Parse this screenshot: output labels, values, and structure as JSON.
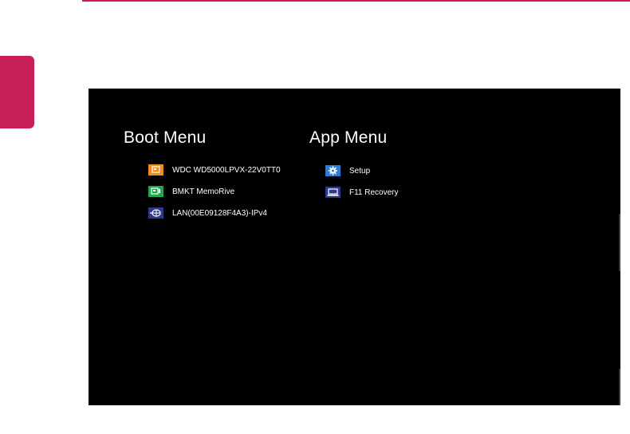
{
  "boot_menu": {
    "title": "Boot Menu",
    "items": [
      {
        "label": "WDC WD5000LPVX-22V0TT0",
        "icon": "hdd-icon",
        "color": "#f08c1e"
      },
      {
        "label": "BMKT MemoRive",
        "icon": "usb-drive-icon",
        "color": "#1fa84a"
      },
      {
        "label": "LAN(00E09128F4A3)-IPv4",
        "icon": "network-icon",
        "color": "#2d3a8c"
      }
    ]
  },
  "app_menu": {
    "title": "App Menu",
    "items": [
      {
        "label": "Setup",
        "icon": "gear-icon",
        "color": "#2a7fd4"
      },
      {
        "label": "F11 Recovery",
        "icon": "laptop-icon",
        "color": "#2d3a8c"
      }
    ]
  },
  "colors": {
    "accent": "#c81e5a",
    "screen_bg": "#000000",
    "text": "#ffffff"
  }
}
